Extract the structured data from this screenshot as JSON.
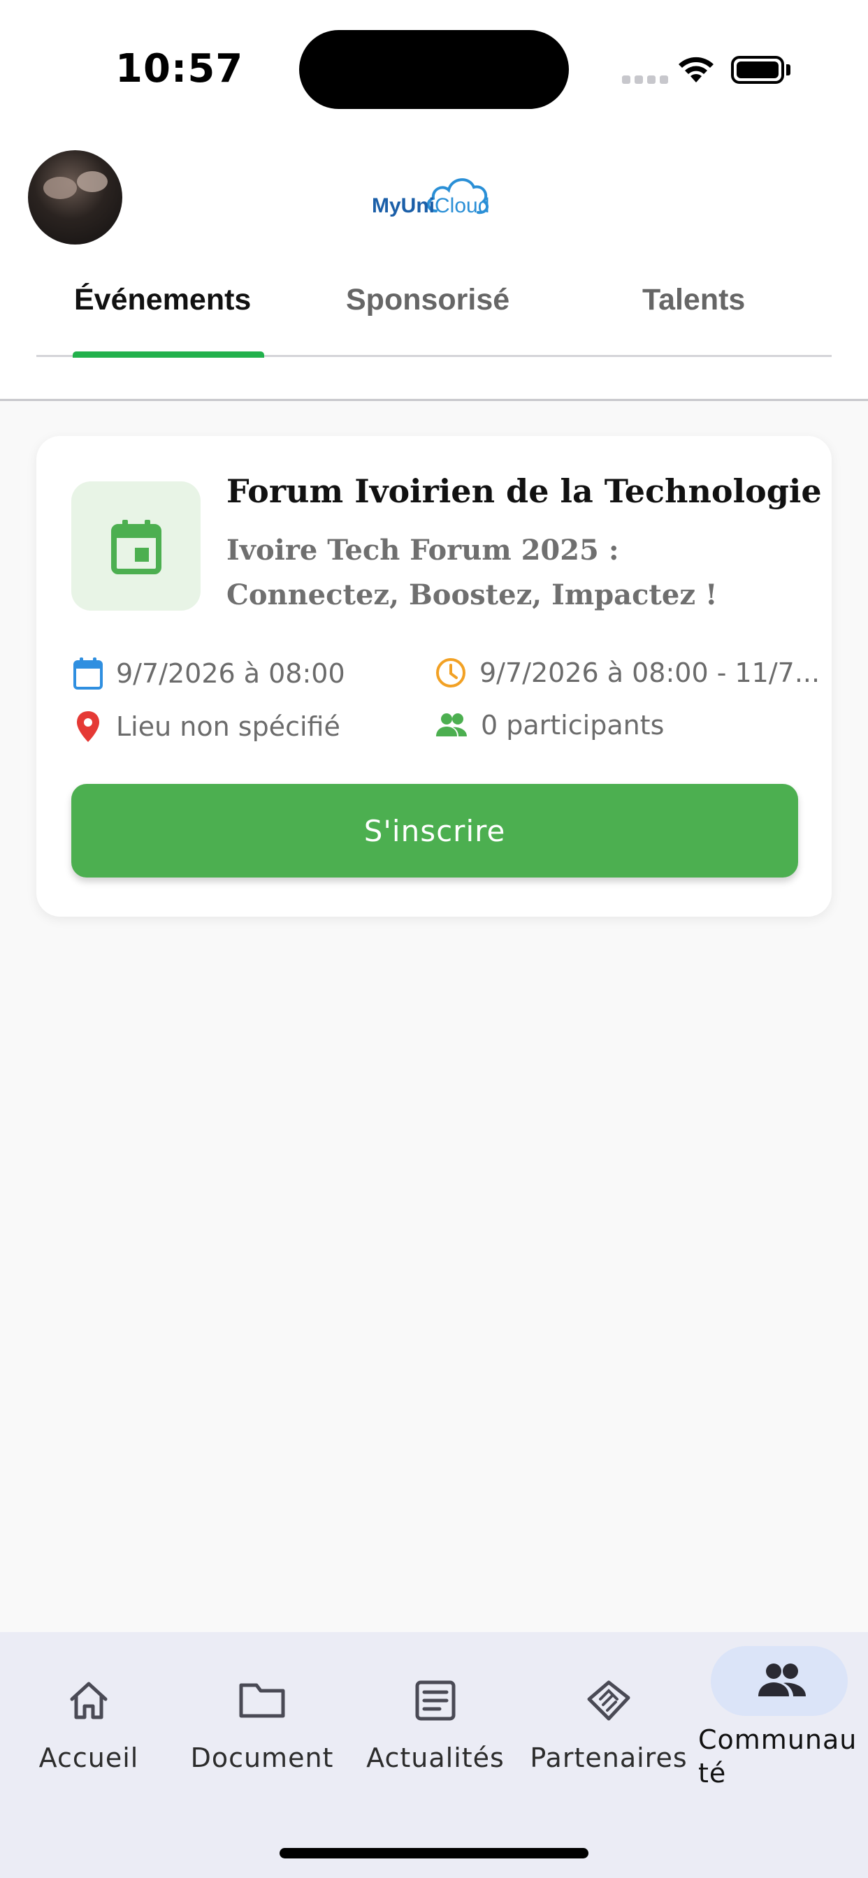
{
  "status_bar": {
    "time": "10:57"
  },
  "header": {
    "logo": {
      "part1": "MyUni",
      "part2": "Cloud"
    },
    "tabs": [
      {
        "label": "Événements",
        "active": true
      },
      {
        "label": "Sponsorisé",
        "active": false
      },
      {
        "label": "Talents",
        "active": false
      }
    ]
  },
  "event_card": {
    "title": "Forum Ivoirien de la Technologie",
    "subtitle": "Ivoire Tech Forum 2025 : Connectez, Boostez, Impactez !",
    "date": "9/7/2026 à 08:00",
    "time_range": "9/7/2026 à 08:00 - 11/7...",
    "location": "Lieu non spécifié",
    "participants": "0 participants",
    "register_label": "S'inscrire",
    "icon": "calendar-icon"
  },
  "bottom_nav": {
    "items": [
      {
        "label": "Accueil",
        "icon": "home-icon"
      },
      {
        "label": "Document",
        "icon": "folder-icon"
      },
      {
        "label": "Actualités",
        "icon": "article-icon"
      },
      {
        "label": "Partenaires",
        "icon": "handshake-icon"
      },
      {
        "label": "Communauté",
        "icon": "people-icon",
        "active": true
      }
    ]
  },
  "colors": {
    "accent_green": "#4caf50",
    "tab_indicator": "#22b14c",
    "calendar_blue": "#2f8fe0",
    "clock_orange": "#f2a124",
    "pin_red": "#e53935",
    "nav_active_pill": "#dbe4f8"
  }
}
